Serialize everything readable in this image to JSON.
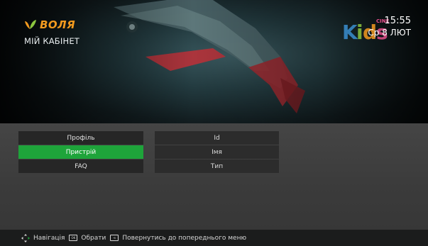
{
  "header": {
    "brand": "ВОЛЯ",
    "title": "МІЙ КАБІНЕТ",
    "time": "15:55",
    "date": "Ср 8 ЛЮТ"
  },
  "channel_logo": {
    "main": "Kids",
    "badge": "CINE"
  },
  "menu": {
    "left": [
      {
        "label": "Профіль",
        "selected": false
      },
      {
        "label": "Пристрій",
        "selected": true
      },
      {
        "label": "FAQ",
        "selected": false
      }
    ],
    "right": [
      {
        "label": "Id"
      },
      {
        "label": "Імя"
      },
      {
        "label": "Тип"
      }
    ]
  },
  "footer": {
    "nav_label": "Навігація",
    "ok_label": "Обрати",
    "back_label": "Повернутись до попереднього меню"
  },
  "colors": {
    "accent_green": "#1ea43a",
    "brand_orange": "#f29a1f",
    "brand_green": "#8cc63f",
    "kids_blue": "#3a8fd0",
    "kids_pink": "#e44f8b"
  },
  "icons": [
    "voliya-logo-icon",
    "navigation-arrows-icon",
    "ok-key-icon",
    "back-key-icon"
  ]
}
